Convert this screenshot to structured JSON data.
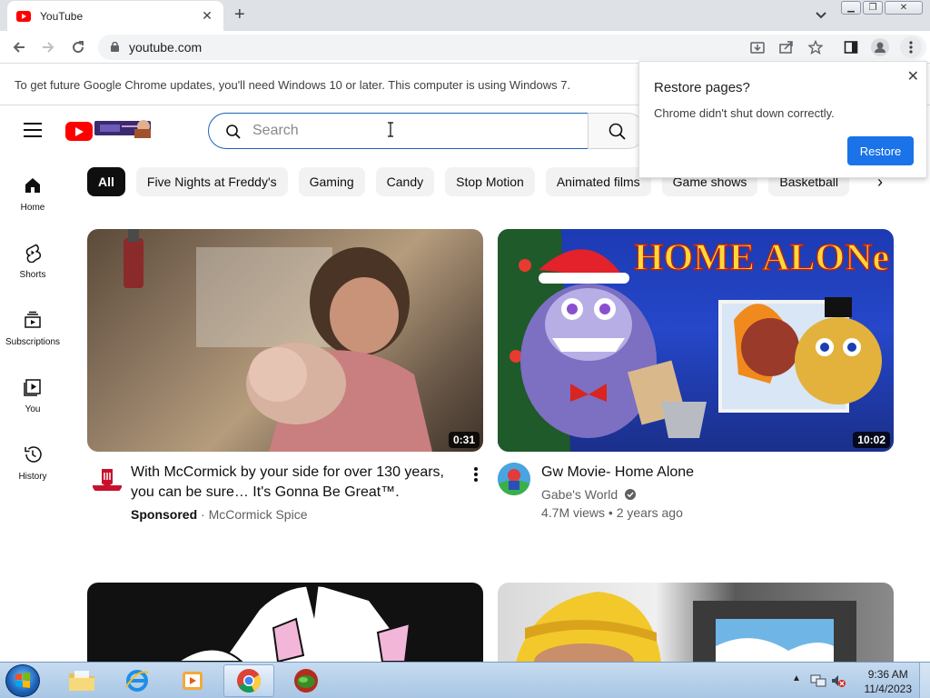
{
  "browser": {
    "tab_title": "YouTube",
    "url": "youtube.com",
    "infobar_text": "To get future Google Chrome updates, you'll need Windows 10 or later. This computer is using Windows 7."
  },
  "restore_popup": {
    "title": "Restore pages?",
    "message": "Chrome didn't shut down correctly.",
    "button": "Restore"
  },
  "youtube": {
    "search_placeholder": "Search",
    "chips": [
      "All",
      "Five Nights at Freddy's",
      "Gaming",
      "Candy",
      "Stop Motion",
      "Animated films",
      "Game shows",
      "Basketball"
    ],
    "sidebar": [
      {
        "label": "Home",
        "icon": "home-icon"
      },
      {
        "label": "Shorts",
        "icon": "shorts-icon"
      },
      {
        "label": "Subscriptions",
        "icon": "subscriptions-icon"
      },
      {
        "label": "You",
        "icon": "you-icon"
      },
      {
        "label": "History",
        "icon": "history-icon"
      }
    ],
    "videos": [
      {
        "title_line1": "With McCormick by your side for over 130 years,",
        "title_line2": "you can be sure… It's Gonna Be Great™.",
        "sponsored": "Sponsored",
        "channel": "McCormick Spice",
        "duration": "0:31"
      },
      {
        "title": "Gw Movie- Home Alone",
        "channel": "Gabe's World",
        "stats": "4.7M views • 2 years ago",
        "duration": "10:02",
        "thumb_text": "HOME ALONe"
      }
    ]
  },
  "taskbar": {
    "time": "9:36 AM",
    "date": "11/4/2023"
  },
  "colors": {
    "youtube_red": "#ff0000",
    "chrome_blue": "#1a73e8",
    "search_border": "#1c62b9"
  }
}
